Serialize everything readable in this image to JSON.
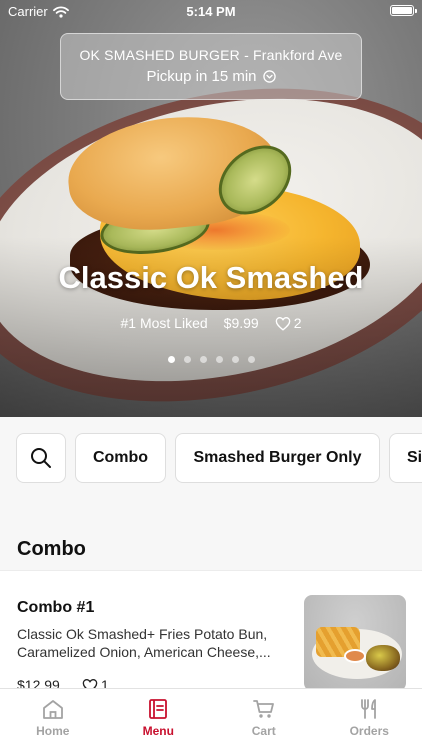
{
  "status_bar": {
    "carrier": "Carrier",
    "time": "5:14 PM"
  },
  "store": {
    "name": "OK SMASHED BURGER - Frankford Ave",
    "pickup": "Pickup in 15 min"
  },
  "hero": {
    "title": "Classic Ok Smashed",
    "badge": "#1 Most Liked",
    "price": "$9.99",
    "likes": "2",
    "slides_total": 6,
    "slide_active": 1
  },
  "categories": [
    "Combo",
    "Smashed Burger Only",
    "Sides"
  ],
  "section": {
    "title": "Combo"
  },
  "items": [
    {
      "name": "Combo #1",
      "description": "Classic Ok Smashed+ Fries Potato Bun, Caramelized Onion, American Cheese,...",
      "price": "$12.99",
      "likes": "1"
    }
  ],
  "tabs": [
    {
      "label": "Home",
      "icon": "home-icon",
      "active": false
    },
    {
      "label": "Menu",
      "icon": "menu-icon",
      "active": true
    },
    {
      "label": "Cart",
      "icon": "cart-icon",
      "active": false
    },
    {
      "label": "Orders",
      "icon": "utensils-icon",
      "active": false
    }
  ],
  "colors": {
    "accent": "#c8102e",
    "inactive": "#a3a3a3"
  }
}
